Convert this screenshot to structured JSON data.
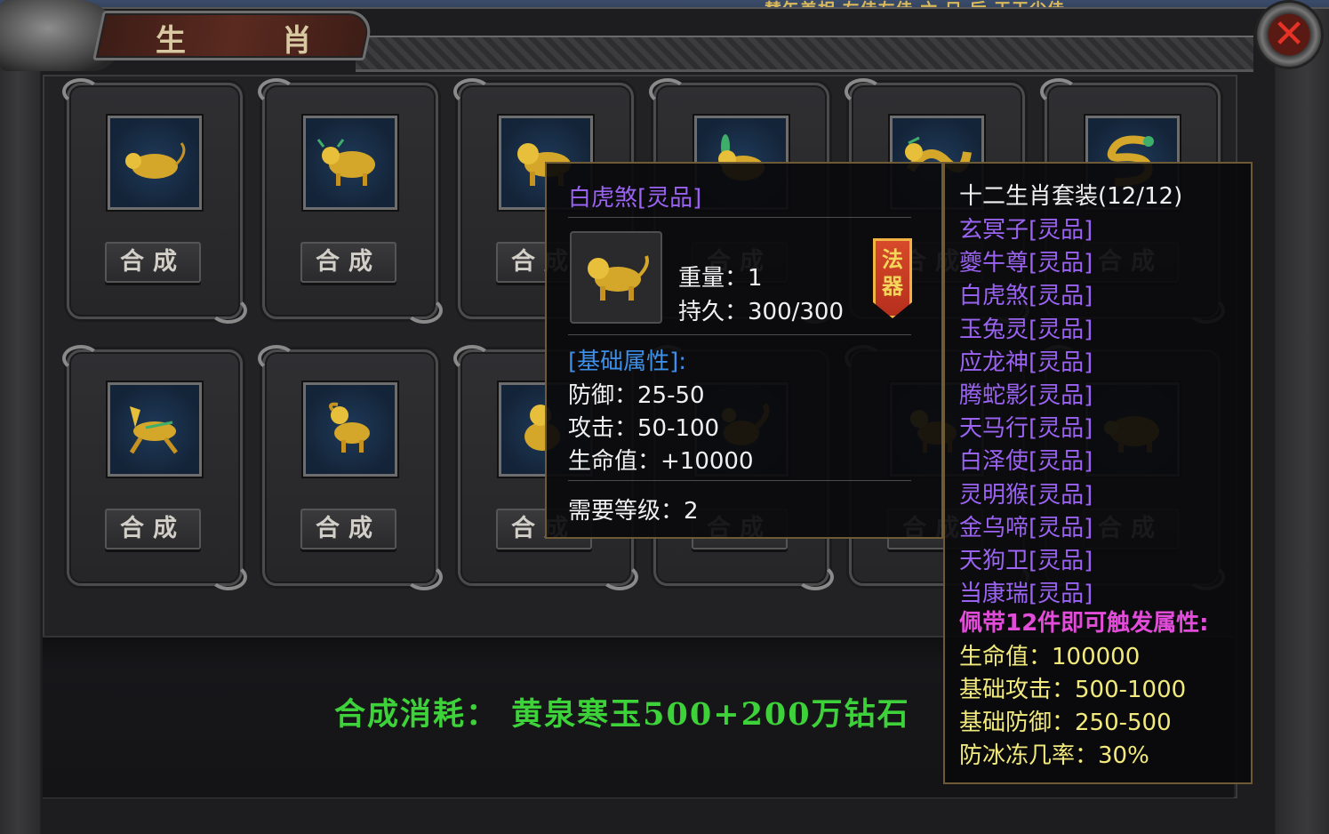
{
  "window": {
    "title": "生 肖",
    "top_strip_text": "替矢差相 左佳左佳 六 日 后 王王尘佳",
    "close_label": "✕"
  },
  "colors": {
    "cost_green": "#3ed23a",
    "item_purple": "#9a63f2",
    "section_blue": "#3d8fe8",
    "set_pink": "#e14cd8",
    "stat_yellow": "#f2ea7c"
  },
  "cards": [
    {
      "icon": "golden-rat-icon",
      "button": "合成"
    },
    {
      "icon": "golden-ox-icon",
      "button": "合成"
    },
    {
      "icon": "golden-tiger-icon",
      "button": "合成"
    },
    {
      "icon": "golden-rabbit-icon",
      "button": "合成"
    },
    {
      "icon": "golden-dragon-icon",
      "button": "合成"
    },
    {
      "icon": "golden-snake-icon",
      "button": "合成"
    },
    {
      "icon": "golden-horse-icon",
      "button": "合成"
    },
    {
      "icon": "golden-goat-icon",
      "button": "合成"
    },
    {
      "icon": "golden-monkey-icon",
      "button": "合成"
    },
    {
      "icon": "golden-rooster-icon",
      "button": "合成"
    },
    {
      "icon": "golden-dog-icon",
      "button": "合成"
    },
    {
      "icon": "golden-pig-icon",
      "button": "合成"
    }
  ],
  "cost": {
    "text": "合成消耗： 黄泉寒玉500+200万钻石"
  },
  "item_tooltip": {
    "name": "白虎煞[灵品]",
    "icon": "golden-tiger-icon",
    "weight": "重量：1",
    "durability": "持久：300/300",
    "badge": "法器",
    "section_label": "[基础属性]:",
    "defense": "防御：25-50",
    "attack": "攻击：50-100",
    "hp": "生命值：+10000",
    "required_level": "需要等级：2"
  },
  "set_tooltip": {
    "title": "十二生肖套装(12/12)",
    "pieces": [
      "玄冥子[灵品]",
      "夔牛尊[灵品]",
      "白虎煞[灵品]",
      "玉兔灵[灵品]",
      "应龙神[灵品]",
      "腾蛇影[灵品]",
      "天马行[灵品]",
      "白泽使[灵品]",
      "灵明猴[灵品]",
      "金乌啼[灵品]",
      "天狗卫[灵品]",
      "当康瑞[灵品]"
    ],
    "trigger": "佩带12件即可触发属性:",
    "bonuses": [
      "生命值：100000",
      "基础攻击：500-1000",
      "基础防御：250-500",
      "防冰冻几率：30%"
    ]
  }
}
